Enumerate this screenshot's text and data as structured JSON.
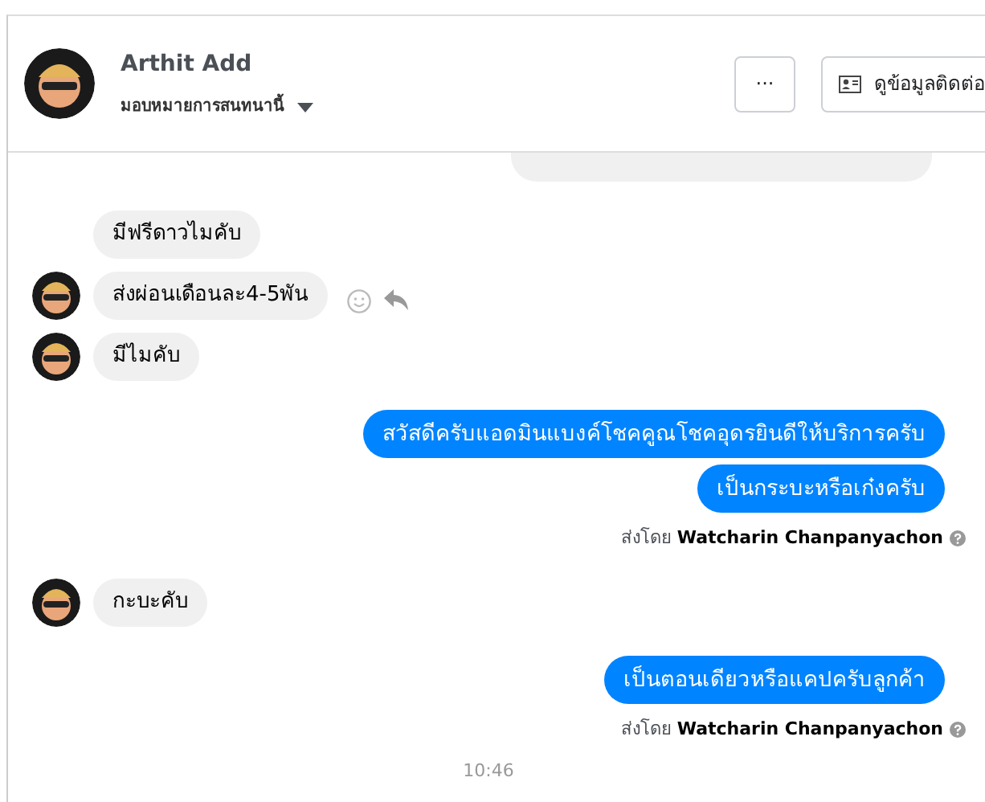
{
  "conversation": {
    "contact_name": "Arthit Add",
    "assign_label": "มอบหมายการสนทนานี้",
    "more_button": "···",
    "contact_button": "ดูข้อมูลติดต่อ"
  },
  "messages": [
    {
      "kind": "fragment"
    },
    {
      "kind": "incoming",
      "text": "มีฟรีดาวไมคับ",
      "avatar": false,
      "actions": false
    },
    {
      "kind": "incoming",
      "text": "ส่งผ่อนเดือนละ4-5พัน",
      "avatar": true,
      "actions": true
    },
    {
      "kind": "incoming",
      "text": "มีไมคับ",
      "avatar": true,
      "actions": false
    },
    {
      "kind": "outgoing",
      "text": "สวัสดีครับแอดมินแบงค์โชคคูณโชคอุดรยินดีให้บริการครับ"
    },
    {
      "kind": "outgoing",
      "text": "เป็นกระบะหรือเก๋งครับ"
    },
    {
      "kind": "sender",
      "prefix": "ส่งโดย",
      "name": "Watcharin Chanpanyachon"
    },
    {
      "kind": "incoming",
      "text": "กะบะคับ",
      "avatar": true,
      "actions": false
    },
    {
      "kind": "outgoing",
      "text": "เป็นตอนเดียวหรือแคปครับลูกค้า"
    },
    {
      "kind": "sender",
      "prefix": "ส่งโดย",
      "name": "Watcharin Chanpanyachon"
    },
    {
      "kind": "time",
      "text": "10:46"
    }
  ]
}
